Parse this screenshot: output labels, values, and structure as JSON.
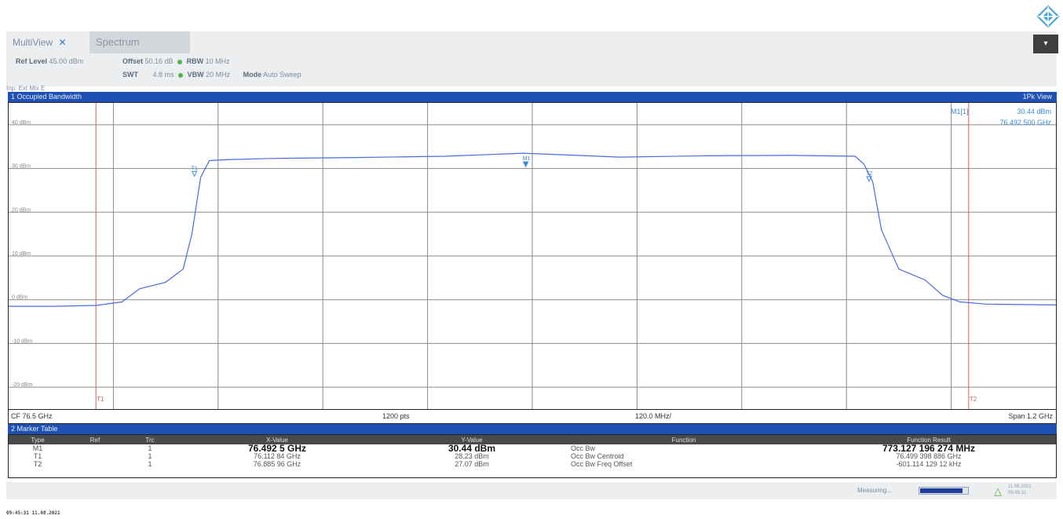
{
  "header": {
    "tabs": [
      {
        "label": "MultiView",
        "icon": "close-x-icon"
      },
      {
        "label": "Spectrum"
      }
    ],
    "collapse_icon": "collapse-icon",
    "logo_icon": "rohde-schwarz-diamond-logo",
    "colors": {
      "accent": "#1f50b4",
      "trace": "#4a6be0",
      "marker_line": "#e06060",
      "status_green": "#52b34a"
    }
  },
  "settings": {
    "ref_level_label": "Ref Level",
    "ref_level_value": "45.00 dBm",
    "offset_label": "Offset",
    "offset_value": "50.16 dB",
    "swt_label": "SWT",
    "swt_value": "4.8 ms",
    "rbw_label": "RBW",
    "rbw_value": "10 MHz",
    "vbw_label": "VBW",
    "vbw_value": "20 MHz",
    "mode_label": "Mode",
    "mode_value": "Auto Sweep",
    "input_label": "Inp: Ext Mix E"
  },
  "panel1": {
    "title": "1 Occupied Bandwidth",
    "trace_label": "1Pk View",
    "marker_readout_label": "M1[1]",
    "marker_readout_level": "30.44 dBm",
    "marker_readout_freq": "76.492 500 GHz",
    "y_ticks": [
      "40 dBm",
      "30 dBm",
      "20 dBm",
      "10 dBm",
      "0 dBm",
      "-10 dBm",
      "-20 dBm"
    ],
    "markers": {
      "m1": "M1",
      "t1": "T1",
      "t2": "T2"
    }
  },
  "footer": {
    "cf": "CF 76.5 GHz",
    "points": "1200 pts",
    "per_div": "120.0 MHz/",
    "span": "Span 1.2 GHz"
  },
  "panel2": {
    "title": "2 Marker Table"
  },
  "marker_table": {
    "headers": [
      "Type",
      "Ref",
      "Trc",
      "X-Value",
      "Y-Value",
      "Function",
      "Function Result"
    ],
    "rows": [
      {
        "type": "M1",
        "ref": "",
        "trc": "1",
        "x": "76.492 5 GHz",
        "y": "30.44 dBm",
        "function": "Occ Bw",
        "result": "773.127 196 274 MHz"
      },
      {
        "type": "T1",
        "ref": "",
        "trc": "1",
        "x": "76.112 84 GHz",
        "y": "28.23 dBm",
        "function": "Occ Bw Centroid",
        "result": "76.499 398 886 GHz"
      },
      {
        "type": "T2",
        "ref": "",
        "trc": "1",
        "x": "76.885 96 GHz",
        "y": "27.07 dBm",
        "function": "Occ Bw Freq Offset",
        "result": "-601.114 129 12 kHz"
      }
    ]
  },
  "status": {
    "measuring": "Measuring...",
    "progress": 0.9,
    "warn_icon": "warning-triangle-icon",
    "status_line1": "11.08.2021",
    "status_line2": "09:45:31"
  },
  "timestamp": "09:45:31  11.08.2021",
  "chart_data": {
    "type": "line",
    "xlim": [
      75.9,
      77.1
    ],
    "ylim": [
      -25,
      45
    ],
    "x_unit": "GHz",
    "y_unit": "dBm",
    "grid": true,
    "series": [
      {
        "name": "Trc 1",
        "x": [
          75.9,
          75.95,
          76.0,
          76.03,
          76.05,
          76.08,
          76.1,
          76.11,
          76.12,
          76.13,
          76.15,
          76.2,
          76.3,
          76.4,
          76.49,
          76.6,
          76.7,
          76.8,
          76.87,
          76.88,
          76.89,
          76.9,
          76.92,
          76.95,
          76.97,
          76.99,
          77.02,
          77.1
        ],
        "y": [
          -1.5,
          -1.5,
          -1.3,
          -0.5,
          2.5,
          4,
          7,
          15,
          28,
          31.8,
          32,
          32.3,
          32.5,
          32.8,
          33.5,
          32.6,
          32.9,
          33,
          32.8,
          31,
          27,
          16,
          7,
          4.5,
          1,
          -0.5,
          -1,
          -1.2
        ]
      }
    ],
    "markers": [
      {
        "name": "M1",
        "x": 76.4925,
        "y": 30.44
      },
      {
        "name": "T1",
        "x": 76.11284,
        "y": 28.23
      },
      {
        "name": "T2",
        "x": 76.88596,
        "y": 27.07
      }
    ],
    "vertical_lines": [
      76.0,
      77.0
    ]
  }
}
